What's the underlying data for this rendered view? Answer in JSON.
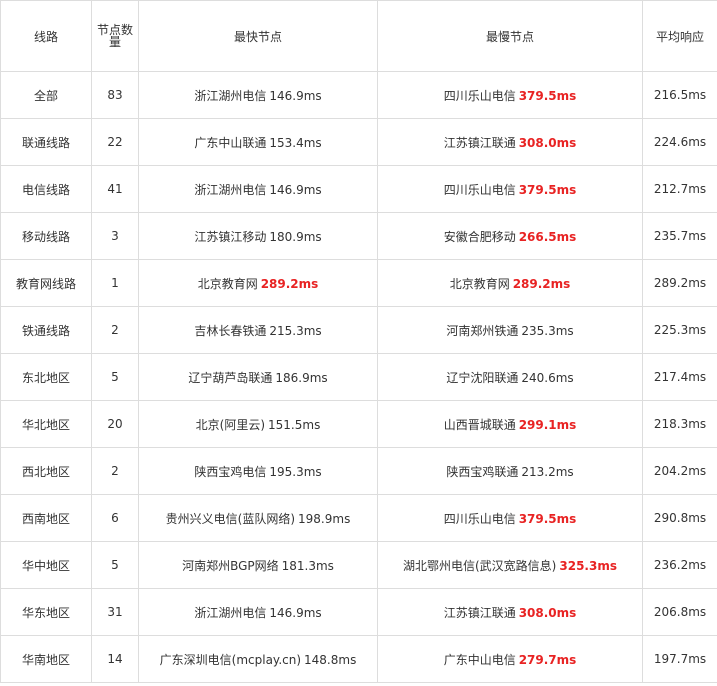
{
  "headers": {
    "route": "线路",
    "count": "节点数量",
    "fastest": "最快节点",
    "slowest": "最慢节点",
    "average": "平均响应"
  },
  "colors": {
    "slow_highlight": "#e82323",
    "border": "#dddddd",
    "text": "#333333"
  },
  "rows": [
    {
      "route": "全部",
      "count": "83",
      "fast_name": "浙江湖州电信",
      "fast_ms": "146.9ms",
      "fast_red": false,
      "slow_name": "四川乐山电信",
      "slow_ms": "379.5ms",
      "slow_red": true,
      "avg": "216.5ms"
    },
    {
      "route": "联通线路",
      "count": "22",
      "fast_name": "广东中山联通",
      "fast_ms": "153.4ms",
      "fast_red": false,
      "slow_name": "江苏镇江联通",
      "slow_ms": "308.0ms",
      "slow_red": true,
      "avg": "224.6ms"
    },
    {
      "route": "电信线路",
      "count": "41",
      "fast_name": "浙江湖州电信",
      "fast_ms": "146.9ms",
      "fast_red": false,
      "slow_name": "四川乐山电信",
      "slow_ms": "379.5ms",
      "slow_red": true,
      "avg": "212.7ms"
    },
    {
      "route": "移动线路",
      "count": "3",
      "fast_name": "江苏镇江移动",
      "fast_ms": "180.9ms",
      "fast_red": false,
      "slow_name": "安徽合肥移动",
      "slow_ms": "266.5ms",
      "slow_red": true,
      "avg": "235.7ms"
    },
    {
      "route": "教育网线路",
      "count": "1",
      "fast_name": "北京教育网",
      "fast_ms": "289.2ms",
      "fast_red": true,
      "slow_name": "北京教育网",
      "slow_ms": "289.2ms",
      "slow_red": true,
      "avg": "289.2ms"
    },
    {
      "route": "铁通线路",
      "count": "2",
      "fast_name": "吉林长春铁通",
      "fast_ms": "215.3ms",
      "fast_red": false,
      "slow_name": "河南郑州铁通",
      "slow_ms": "235.3ms",
      "slow_red": false,
      "avg": "225.3ms"
    },
    {
      "route": "东北地区",
      "count": "5",
      "fast_name": "辽宁葫芦岛联通",
      "fast_ms": "186.9ms",
      "fast_red": false,
      "slow_name": "辽宁沈阳联通",
      "slow_ms": "240.6ms",
      "slow_red": false,
      "avg": "217.4ms"
    },
    {
      "route": "华北地区",
      "count": "20",
      "fast_name": "北京(阿里云)",
      "fast_ms": "151.5ms",
      "fast_red": false,
      "slow_name": "山西晋城联通",
      "slow_ms": "299.1ms",
      "slow_red": true,
      "avg": "218.3ms"
    },
    {
      "route": "西北地区",
      "count": "2",
      "fast_name": "陕西宝鸡电信",
      "fast_ms": "195.3ms",
      "fast_red": false,
      "slow_name": "陕西宝鸡联通",
      "slow_ms": "213.2ms",
      "slow_red": false,
      "avg": "204.2ms"
    },
    {
      "route": "西南地区",
      "count": "6",
      "fast_name": "贵州兴义电信(蓝队网络)",
      "fast_ms": "198.9ms",
      "fast_red": false,
      "slow_name": "四川乐山电信",
      "slow_ms": "379.5ms",
      "slow_red": true,
      "avg": "290.8ms"
    },
    {
      "route": "华中地区",
      "count": "5",
      "fast_name": "河南郑州BGP网络",
      "fast_ms": "181.3ms",
      "fast_red": false,
      "slow_name": "湖北鄂州电信(武汉宽路信息)",
      "slow_ms": "325.3ms",
      "slow_red": true,
      "avg": "236.2ms"
    },
    {
      "route": "华东地区",
      "count": "31",
      "fast_name": "浙江湖州电信",
      "fast_ms": "146.9ms",
      "fast_red": false,
      "slow_name": "江苏镇江联通",
      "slow_ms": "308.0ms",
      "slow_red": true,
      "avg": "206.8ms"
    },
    {
      "route": "华南地区",
      "count": "14",
      "fast_name": "广东深圳电信(mcplay.cn)",
      "fast_ms": "148.8ms",
      "fast_red": false,
      "slow_name": "广东中山电信",
      "slow_ms": "279.7ms",
      "slow_red": true,
      "avg": "197.7ms"
    }
  ]
}
